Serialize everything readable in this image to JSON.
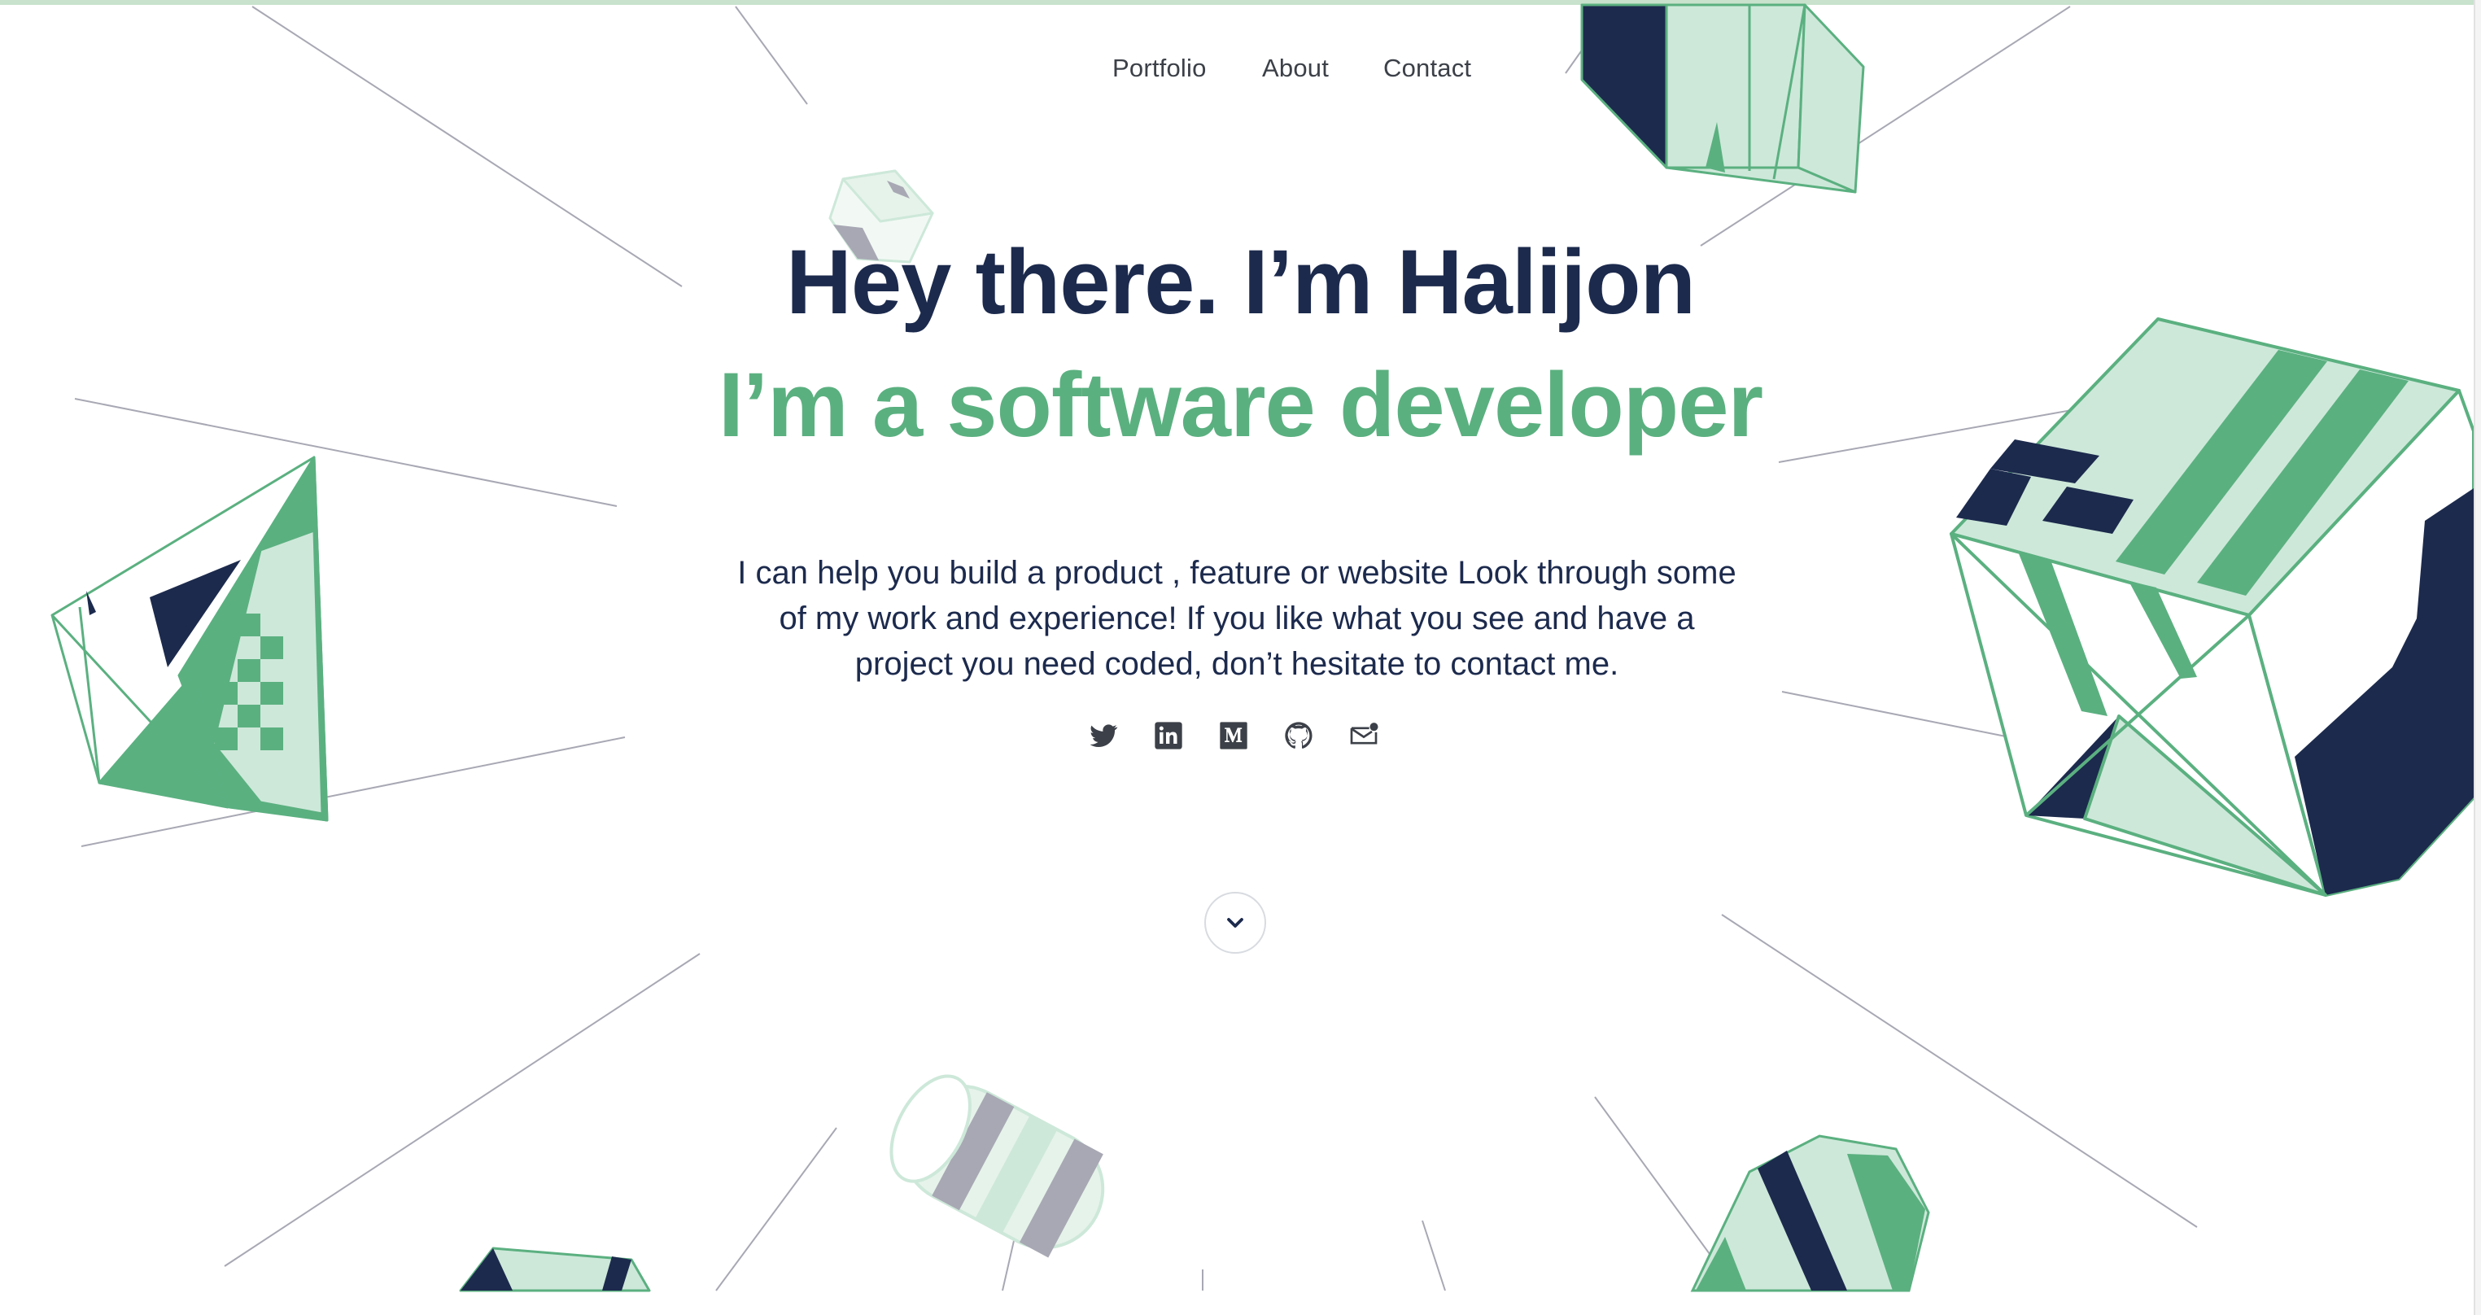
{
  "nav": {
    "items": [
      {
        "label": "Portfolio"
      },
      {
        "label": "About"
      },
      {
        "label": "Contact"
      }
    ]
  },
  "hero": {
    "greeting": "Hey there. I’m Halijon",
    "role": "I’m a software developer"
  },
  "intro": {
    "text": "I can help you build a product , feature or website Look through some of my work and experience! If you like what you see and have a project you need coded, don’t hesitate to contact me."
  },
  "socials": [
    {
      "icon": "twitter-icon"
    },
    {
      "icon": "linkedin-icon"
    },
    {
      "icon": "medium-icon"
    },
    {
      "icon": "github-icon"
    },
    {
      "icon": "mail-icon"
    }
  ],
  "scroll": {
    "icon": "chevron-down-icon"
  },
  "colors": {
    "navy": "#1c2a4d",
    "green": "#5bb080",
    "mint": "#cde8d9",
    "line": "#a8a8b4",
    "nav_text": "#3c4048"
  }
}
